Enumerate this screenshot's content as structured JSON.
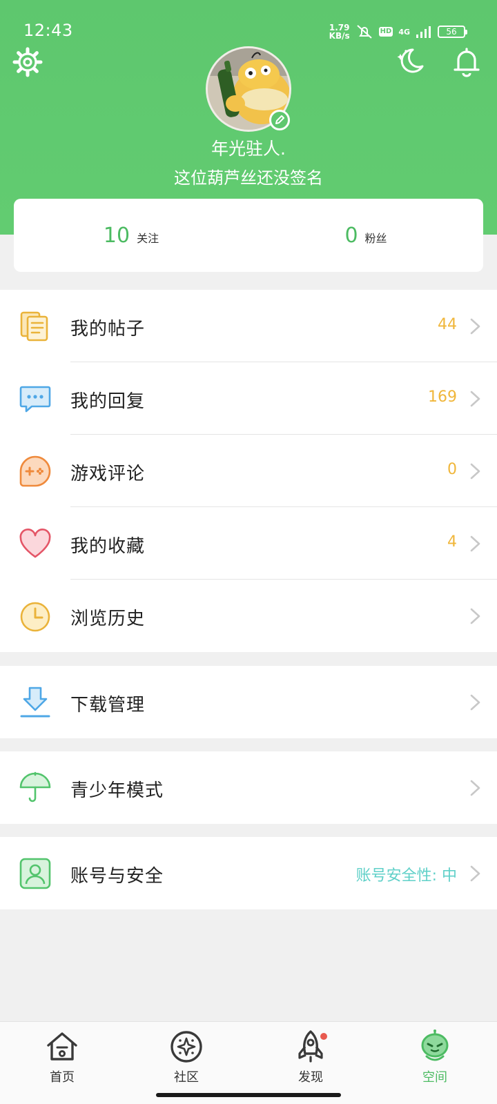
{
  "status_bar": {
    "time": "12:43",
    "net_speed_value": "1.79",
    "net_speed_unit": "KB/s",
    "hd": "HD",
    "network": "4G",
    "battery": "56"
  },
  "header": {
    "username": "年光驻人.",
    "signature": "这位葫芦丝还没签名",
    "settings_icon": "gear-icon",
    "night_mode_icon": "moon-stars-icon",
    "notification_icon": "bell-icon",
    "edit_icon": "pencil-icon"
  },
  "stats": {
    "following": {
      "value": "10",
      "label": "关注"
    },
    "followers": {
      "value": "0",
      "label": "粉丝"
    }
  },
  "menu": {
    "my_posts": {
      "label": "我的帖子",
      "count": "44",
      "icon": "document-stack-icon"
    },
    "my_replies": {
      "label": "我的回复",
      "count": "169",
      "icon": "chat-bubble-icon"
    },
    "game_reviews": {
      "label": "游戏评论",
      "count": "0",
      "icon": "gamepad-icon"
    },
    "favorites": {
      "label": "我的收藏",
      "count": "4",
      "icon": "heart-icon"
    },
    "history": {
      "label": "浏览历史",
      "icon": "clock-icon"
    },
    "downloads": {
      "label": "下载管理",
      "icon": "download-icon"
    },
    "teen_mode": {
      "label": "青少年模式",
      "icon": "umbrella-icon"
    },
    "account": {
      "label": "账号与安全",
      "status": "账号安全性: 中",
      "icon": "user-card-icon"
    }
  },
  "bottom_nav": {
    "home": {
      "label": "首页",
      "icon": "house-icon"
    },
    "community": {
      "label": "社区",
      "icon": "sparkle-circle-icon"
    },
    "discover": {
      "label": "发现",
      "icon": "rocket-icon"
    },
    "space": {
      "label": "空间",
      "icon": "alien-face-icon"
    }
  },
  "colors": {
    "header_green": "#5ec76e",
    "accent_green": "#4cbb62",
    "count_orange": "#f0b63a",
    "security_cyan": "#5fd0c8"
  }
}
